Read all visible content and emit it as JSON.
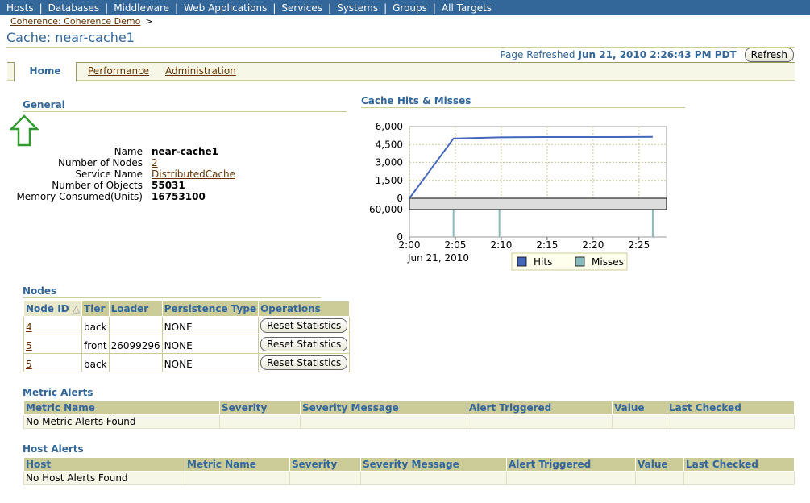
{
  "nav": {
    "items": [
      "Hosts",
      "Databases",
      "Middleware",
      "Web Applications",
      "Services",
      "Systems",
      "Groups",
      "All Targets"
    ]
  },
  "breadcrumb": {
    "link": "Coherence: Coherence Demo",
    "arrow": ">"
  },
  "page": {
    "title": "Cache: near-cache1"
  },
  "refresh": {
    "label": "Page Refreshed",
    "timestamp": "Jun 21, 2010 2:26:43 PM PDT",
    "button": "Refresh"
  },
  "tabs": {
    "home": "Home",
    "performance": "Performance",
    "administration": "Administration"
  },
  "general": {
    "title": "General",
    "name_label": "Name",
    "name_value": "near-cache1",
    "nodes_label": "Number of Nodes",
    "nodes_value": "2",
    "service_label": "Service Name",
    "service_value": "DistributedCache",
    "objects_label": "Number of Objects",
    "objects_value": "55031",
    "memory_label": "Memory Consumed(Units)",
    "memory_value": "16753100"
  },
  "chart_section": {
    "title": "Cache Hits & Misses"
  },
  "chart_data": {
    "type": "line",
    "title": "Cache Hits & Misses",
    "upper": {
      "yticks": [
        "6,000",
        "4,500",
        "3,000",
        "1,500",
        "0"
      ],
      "ylim": [
        0,
        6000
      ]
    },
    "lower": {
      "yticks": [
        "60,000",
        "0"
      ],
      "ylim": [
        0,
        60000
      ]
    },
    "xticks": [
      "2:00",
      "2:05",
      "2:10",
      "2:15",
      "2:20",
      "2:25"
    ],
    "xsub": "Jun 21, 2010",
    "series": [
      {
        "name": "Hits",
        "color": "#4466bb",
        "x": [
          0,
          4.8,
          9.8,
          14.8,
          19.8,
          24.8,
          26.5
        ],
        "y": [
          0,
          5000,
          5100,
          5120,
          5120,
          5130,
          5140
        ]
      },
      {
        "name": "Misses",
        "color": "#88bbbb",
        "x": [
          4.8,
          9.8,
          26.5
        ],
        "y": [
          60000,
          60000,
          60000
        ]
      }
    ]
  },
  "nodes": {
    "title": "Nodes",
    "headers": [
      "Node ID",
      "Tier",
      "Loader",
      "Persistence Type",
      "Operations"
    ],
    "rows": [
      {
        "id": "4",
        "tier": "back",
        "loader": "",
        "persistence": "NONE",
        "op": "Reset Statistics"
      },
      {
        "id": "5",
        "tier": "front",
        "loader": "26099296",
        "persistence": "NONE",
        "op": "Reset Statistics"
      },
      {
        "id": "5",
        "tier": "back",
        "loader": "",
        "persistence": "NONE",
        "op": "Reset Statistics"
      }
    ]
  },
  "metric_alerts": {
    "title": "Metric Alerts",
    "headers": [
      "Metric Name",
      "Severity",
      "Severity Message",
      "Alert Triggered",
      "Value",
      "Last Checked"
    ],
    "empty": "No Metric Alerts Found"
  },
  "host_alerts": {
    "title": "Host Alerts",
    "headers": [
      "Host",
      "Metric Name",
      "Severity",
      "Severity Message",
      "Alert Triggered",
      "Value",
      "Last Checked"
    ],
    "empty": "No Host Alerts Found"
  }
}
